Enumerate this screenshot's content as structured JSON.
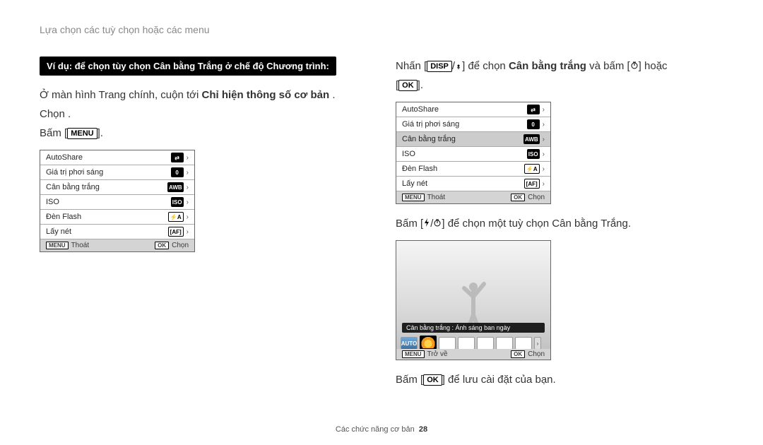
{
  "header": {
    "title": "Lựa chọn các tuỳ chọn hoặc các menu"
  },
  "left": {
    "example_bar": "Ví dụ: để chọn tùy chọn Cân bằng Trắng ở chế độ Chương trình:",
    "line1_pre": "Ở màn hình Trang chính, cuộn tới ",
    "line1_bold": "Chỉ hiện thông số cơ bản",
    "line1_post": "  .",
    "line2": "Chọn     .",
    "line3_pre": "Bấm [",
    "line3_btn": "MENU",
    "line3_post": "].",
    "menu": {
      "items": [
        {
          "label": "AutoShare",
          "right": "⇄"
        },
        {
          "label": "Giá trị phơi sáng",
          "right": "0"
        },
        {
          "label": "Cân bằng trắng",
          "right": "AWB"
        },
        {
          "label": "ISO",
          "right": "ISO"
        },
        {
          "label": "Đèn Flash",
          "right": "⚡A"
        },
        {
          "label": "Lấy nét",
          "right": "[AF]"
        }
      ],
      "footer": {
        "left_btn": "MENU",
        "left_text": "Thoát",
        "right_btn": "OK",
        "right_text": "Chọn"
      }
    }
  },
  "right": {
    "line1_pre": "Nhấn [",
    "line1_btn": "DISP",
    "line1_mid": "/",
    "line1_mid2": "] để chọn ",
    "line1_bold": "Cân bằng trắng",
    "line1_post": " và bấm [",
    "line1_post2": "] hoặc",
    "line1c_pre": "[",
    "line1c_btn": "OK",
    "line1c_post": "].",
    "menu": {
      "items": [
        {
          "label": "AutoShare",
          "right": "⇄"
        },
        {
          "label": "Giá trị phơi sáng",
          "right": "0"
        },
        {
          "label": "Cân bằng trắng",
          "right": "AWB",
          "selected": true
        },
        {
          "label": "ISO",
          "right": "ISO"
        },
        {
          "label": "Đèn Flash",
          "right": "⚡A"
        },
        {
          "label": "Lấy nét",
          "right": "[AF]"
        }
      ],
      "footer": {
        "left_btn": "MENU",
        "left_text": "Thoát",
        "right_btn": "OK",
        "right_text": "Chọn"
      }
    },
    "line2_pre": "Bấm [",
    "line2_mid": "/",
    "line2_post": "] để chọn một tuỳ chọn Cân bằng Trắng.",
    "preview": {
      "caption": "Cân bằng trắng : Ánh sáng ban ngày",
      "thumbs": [
        "AUTO",
        "",
        "",
        "",
        "",
        "",
        "",
        ""
      ],
      "footer": {
        "left_btn": "MENU",
        "left_text": "Trở về",
        "right_btn": "OK",
        "right_text": "Chọn"
      }
    },
    "line3_pre": "Bấm [",
    "line3_btn": "OK",
    "line3_post": "] để lưu cài đặt của bạn."
  },
  "footer": {
    "text": "Các chức năng cơ bản",
    "page": "28"
  }
}
